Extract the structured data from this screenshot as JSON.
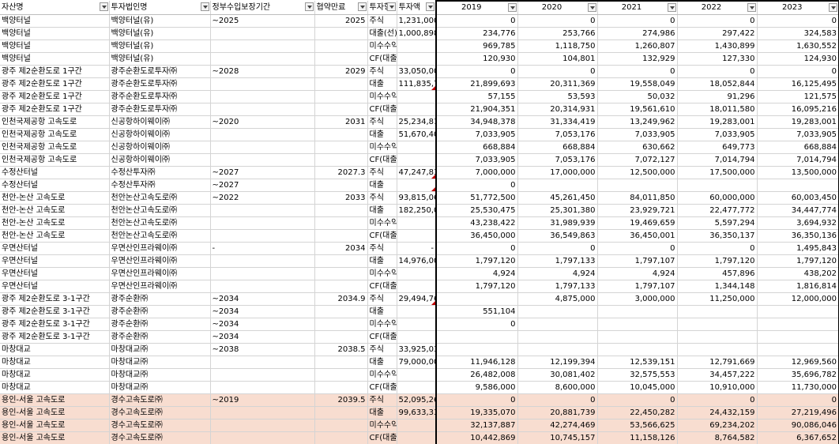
{
  "headers": [
    "자산명",
    "투자법인명",
    "정부수입보장기간",
    "협약만료",
    "투자형",
    "투자액",
    "2019",
    "2020",
    "2021",
    "2022",
    "2023"
  ],
  "rows": [
    [
      "백양터널",
      "백양터널(유)",
      "~2025",
      "2025",
      "주식",
      "1,231,000",
      "0",
      "0",
      "0",
      "0",
      "0"
    ],
    [
      "백양터널",
      "백양터널(유)",
      "",
      "",
      "대출(선)",
      "1,000,898",
      "234,776",
      "253,766",
      "274,986",
      "297,422",
      "324,583"
    ],
    [
      "백양터널",
      "백양터널(유)",
      "",
      "",
      "미수수익",
      "",
      "969,785",
      "1,118,750",
      "1,260,807",
      "1,430,899",
      "1,630,552"
    ],
    [
      "백양터널",
      "백양터널(유)",
      "",
      "",
      "CF(대출)",
      "",
      "120,930",
      "104,801",
      "132,929",
      "127,330",
      "124,930"
    ],
    [
      "광주 제2순환도로 1구간",
      "광주순환도로투자㈜",
      "~2028",
      "2029",
      "주식",
      "33,050,000",
      "0",
      "0",
      "0",
      "0",
      "0"
    ],
    [
      "광주 제2순환도로 1구간",
      "광주순환도로투자㈜",
      "",
      "",
      "대출",
      "111,835,741",
      "21,899,693",
      "20,311,369",
      "19,558,049",
      "18,052,844",
      "16,125,495"
    ],
    [
      "광주 제2순환도로 1구간",
      "광주순환도로투자㈜",
      "",
      "",
      "미수수익",
      "",
      "57,155",
      "53,593",
      "50,032",
      "91,296",
      "121,575"
    ],
    [
      "광주 제2순환도로 1구간",
      "광주순환도로투자㈜",
      "",
      "",
      "CF(대출)",
      "",
      "21,904,351",
      "20,314,931",
      "19,561,610",
      "18,011,580",
      "16,095,216"
    ],
    [
      "인천국제공항 고속도로",
      "신공항하이웨이㈜",
      "~2020",
      "2031",
      "주식",
      "25,234,813",
      "34,948,378",
      "31,334,419",
      "13,249,962",
      "19,283,001",
      "19,283,001"
    ],
    [
      "인천국제공항 고속도로",
      "신공항하이웨이㈜",
      "",
      "",
      "대출",
      "51,670,400",
      "7,033,905",
      "7,053,176",
      "7,033,905",
      "7,033,905",
      "7,033,905"
    ],
    [
      "인천국제공항 고속도로",
      "신공항하이웨이㈜",
      "",
      "",
      "미수수익",
      "",
      "668,884",
      "668,884",
      "630,662",
      "649,773",
      "668,884"
    ],
    [
      "인천국제공항 고속도로",
      "신공항하이웨이㈜",
      "",
      "",
      "CF(대출)",
      "",
      "7,033,905",
      "7,053,176",
      "7,072,127",
      "7,014,794",
      "7,014,794"
    ],
    [
      "수정산터널",
      "수정산투자㈜",
      "~2027",
      "2027.3",
      "주식",
      "47,247,830",
      "7,000,000",
      "17,000,000",
      "12,500,000",
      "17,500,000",
      "13,500,000"
    ],
    [
      "수정산터널",
      "수정산투자㈜",
      "~2027",
      "",
      "대출",
      "",
      "0",
      "",
      "",
      "",
      ""
    ],
    [
      "천안-논산 고속도로",
      "천안논산고속도로㈜",
      "~2022",
      "2033",
      "주식",
      "93,815,060",
      "51,772,500",
      "45,261,450",
      "84,011,850",
      "60,000,000",
      "60,003,450"
    ],
    [
      "천안-논산 고속도로",
      "천안논산고속도로㈜",
      "",
      "",
      "대출",
      "182,250,000",
      "25,530,475",
      "25,301,380",
      "23,929,721",
      "22,477,772",
      "34,447,774"
    ],
    [
      "천안-논산 고속도로",
      "천안논산고속도로㈜",
      "",
      "",
      "미수수익",
      "",
      "43,238,422",
      "31,989,939",
      "19,469,659",
      "5,597,294",
      "3,694,932"
    ],
    [
      "천안-논산 고속도로",
      "천안논산고속도로㈜",
      "",
      "",
      "CF(대출)",
      "",
      "36,450,000",
      "36,549,863",
      "36,450,001",
      "36,350,137",
      "36,350,136"
    ],
    [
      "우면산터널",
      "우면산인프라웨이㈜",
      "-",
      "2034",
      "주식",
      "-",
      "0",
      "0",
      "0",
      "0",
      "1,495,843"
    ],
    [
      "우면산터널",
      "우면산인프라웨이㈜",
      "",
      "",
      "대출",
      "14,976,000",
      "1,797,120",
      "1,797,133",
      "1,797,107",
      "1,797,120",
      "1,797,120"
    ],
    [
      "우면산터널",
      "우면산인프라웨이㈜",
      "",
      "",
      "미수수익",
      "",
      "4,924",
      "4,924",
      "4,924",
      "457,896",
      "438,202"
    ],
    [
      "우면산터널",
      "우면산인프라웨이㈜",
      "",
      "",
      "CF(대출)",
      "",
      "1,797,120",
      "1,797,133",
      "1,797,107",
      "1,344,148",
      "1,816,814"
    ],
    [
      "광주 제2순환도로 3-1구간",
      "광주순환㈜",
      "~2034",
      "2034.9",
      "주식",
      "29,494,767",
      "",
      "4,875,000",
      "3,000,000",
      "11,250,000",
      "12,000,000"
    ],
    [
      "광주 제2순환도로 3-1구간",
      "광주순환㈜",
      "~2034",
      "",
      "대출",
      "",
      "551,104",
      "",
      "",
      "",
      ""
    ],
    [
      "광주 제2순환도로 3-1구간",
      "광주순환㈜",
      "~2034",
      "",
      "미수수익",
      "",
      "0",
      "",
      "",
      "",
      ""
    ],
    [
      "광주 제2순환도로 3-1구간",
      "광주순환㈜",
      "~2034",
      "",
      "CF(대출)",
      "",
      "",
      "",
      "",
      "",
      ""
    ],
    [
      "마창대교",
      "마창대교㈜",
      "~2038",
      "2038.5",
      "주식",
      "33,925,039",
      "",
      "",
      "",
      "",
      ""
    ],
    [
      "마창대교",
      "마창대교㈜",
      "",
      "",
      "대출",
      "79,000,000",
      "11,946,128",
      "12,199,394",
      "12,539,151",
      "12,791,669",
      "12,969,560"
    ],
    [
      "마창대교",
      "마창대교㈜",
      "",
      "",
      "미수수익",
      "",
      "26,482,008",
      "30,081,402",
      "32,575,553",
      "34,457,222",
      "35,696,782"
    ],
    [
      "마창대교",
      "마창대교㈜",
      "",
      "",
      "CF(대출)",
      "",
      "9,586,000",
      "8,600,000",
      "10,045,000",
      "10,910,000",
      "11,730,000"
    ],
    [
      "용인-서울 고속도로",
      "경수고속도로㈜",
      "~2019",
      "2039.5",
      "주식",
      "52,095,263",
      "0",
      "0",
      "0",
      "0",
      "0"
    ],
    [
      "용인-서울 고속도로",
      "경수고속도로㈜",
      "",
      "",
      "대출",
      "99,633,333",
      "19,335,070",
      "20,881,739",
      "22,450,282",
      "24,432,159",
      "27,219,496"
    ],
    [
      "용인-서울 고속도로",
      "경수고속도로㈜",
      "",
      "",
      "미수수익",
      "",
      "32,137,887",
      "42,274,469",
      "53,566,625",
      "69,234,202",
      "90,086,046"
    ],
    [
      "용인-서울 고속도로",
      "경수고속도로㈜",
      "",
      "",
      "CF(대출)",
      "",
      "10,442,869",
      "10,745,157",
      "11,158,126",
      "8,764,582",
      "6,367,652"
    ]
  ],
  "highlight_rows": [
    30,
    31,
    32,
    33
  ],
  "comment_marker_rows": [
    5,
    12,
    13,
    22
  ],
  "colors": {
    "highlight": "#f8ddd0",
    "grid": "#d4d4d4",
    "comment": "#c00000"
  }
}
